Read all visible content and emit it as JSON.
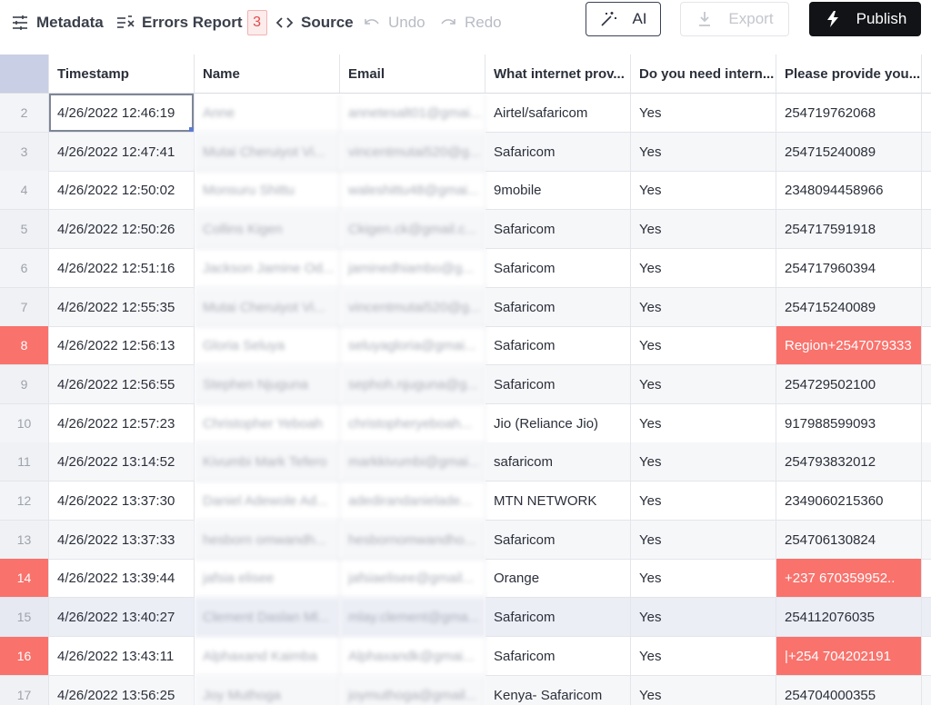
{
  "toolbar": {
    "metadata": "Metadata",
    "errors_report": "Errors Report",
    "errors_count": "3",
    "source": "Source",
    "undo": "Undo",
    "redo": "Redo",
    "ai": "AI",
    "export": "Export",
    "publish": "Publish"
  },
  "table": {
    "columns": [
      "Timestamp",
      "Name",
      "Email",
      "What internet prov...",
      "Do you need intern...",
      "Please provide you..."
    ],
    "rows": [
      {
        "n": "2",
        "ts": "4/26/2022 12:46:19",
        "name": "Anne",
        "email": "annetesalt01@gmai...",
        "isp": "Airtel/safaricom",
        "need": "Yes",
        "phone": "254719762068"
      },
      {
        "n": "3",
        "ts": "4/26/2022 12:47:41",
        "name": "Mutai Cheruiyot Vi...",
        "email": "vincentmutai520@g...",
        "isp": "Safaricom",
        "need": "Yes",
        "phone": "254715240089"
      },
      {
        "n": "4",
        "ts": "4/26/2022 12:50:02",
        "name": "Monsuru Shittu",
        "email": "waleshittu48@gmai...",
        "isp": "9mobile",
        "need": "Yes",
        "phone": "2348094458966"
      },
      {
        "n": "5",
        "ts": "4/26/2022 12:50:26",
        "name": "Collins Kigen",
        "email": "Ckigen.ck@gmail.c...",
        "isp": "Safaricom",
        "need": "Yes",
        "phone": "254717591918"
      },
      {
        "n": "6",
        "ts": "4/26/2022 12:51:16",
        "name": "Jackson Jamine Od...",
        "email": "jaminedhiambo@g...",
        "isp": "Safaricom",
        "need": "Yes",
        "phone": "254717960394"
      },
      {
        "n": "7",
        "ts": "4/26/2022 12:55:35",
        "name": "Mutai Cheruiyot Vi...",
        "email": "vincentmutai520@g...",
        "isp": "Safaricom",
        "need": "Yes",
        "phone": "254715240089"
      },
      {
        "n": "8",
        "ts": "4/26/2022 12:56:13",
        "name": "Gloria Seluya",
        "email": "seluyagloria@gmai...",
        "isp": "Safaricom",
        "need": "Yes",
        "phone": "Region+2547079333"
      },
      {
        "n": "9",
        "ts": "4/26/2022 12:56:55",
        "name": "Stephen Njuguna",
        "email": "sephoh.njuguna@g...",
        "isp": "Safaricom",
        "need": "Yes",
        "phone": "254729502100"
      },
      {
        "n": "10",
        "ts": "4/26/2022 12:57:23",
        "name": "Christopher Yeboah",
        "email": "christopheryeboah...",
        "isp": "Jio (Reliance Jio)",
        "need": "Yes",
        "phone": "917988599093"
      },
      {
        "n": "11",
        "ts": "4/26/2022 13:14:52",
        "name": "Kivumbi Mark Tefero",
        "email": "markkivumbi@gmai...",
        "isp": "safaricom",
        "need": "Yes",
        "phone": "254793832012"
      },
      {
        "n": "12",
        "ts": "4/26/2022 13:37:30",
        "name": "Daniel Adewole Ad...",
        "email": "adedirandanielade...",
        "isp": "MTN NETWORK",
        "need": "Yes",
        "phone": "2349060215360"
      },
      {
        "n": "13",
        "ts": "4/26/2022 13:37:33",
        "name": "hesborn omwandh...",
        "email": "hesbornomwandho...",
        "isp": "Safaricom",
        "need": "Yes",
        "phone": "254706130824"
      },
      {
        "n": "14",
        "ts": "4/26/2022 13:39:44",
        "name": "jafsia elisee",
        "email": "jafsiaelisee@gmail...",
        "isp": "Orange",
        "need": "Yes",
        "phone": "+237 670359952.."
      },
      {
        "n": "15",
        "ts": "4/26/2022 13:40:27",
        "name": "Clement Daslan Ml...",
        "email": "mlay.clement@gma...",
        "isp": "Safaricom",
        "need": "Yes",
        "phone": "254112076035"
      },
      {
        "n": "16",
        "ts": "4/26/2022 13:43:11",
        "name": "Alphaxand Kaimba",
        "email": "Alphaxandk@gmai...",
        "isp": "Safaricom",
        "need": "Yes",
        "phone": "|+254 704202191"
      },
      {
        "n": "17",
        "ts": "4/26/2022 13:56:25",
        "name": "Joy Muthoga",
        "email": "joymuthoga@gmail...",
        "isp": "Kenya- Safaricom",
        "need": "Yes",
        "phone": "254704000355"
      }
    ]
  }
}
